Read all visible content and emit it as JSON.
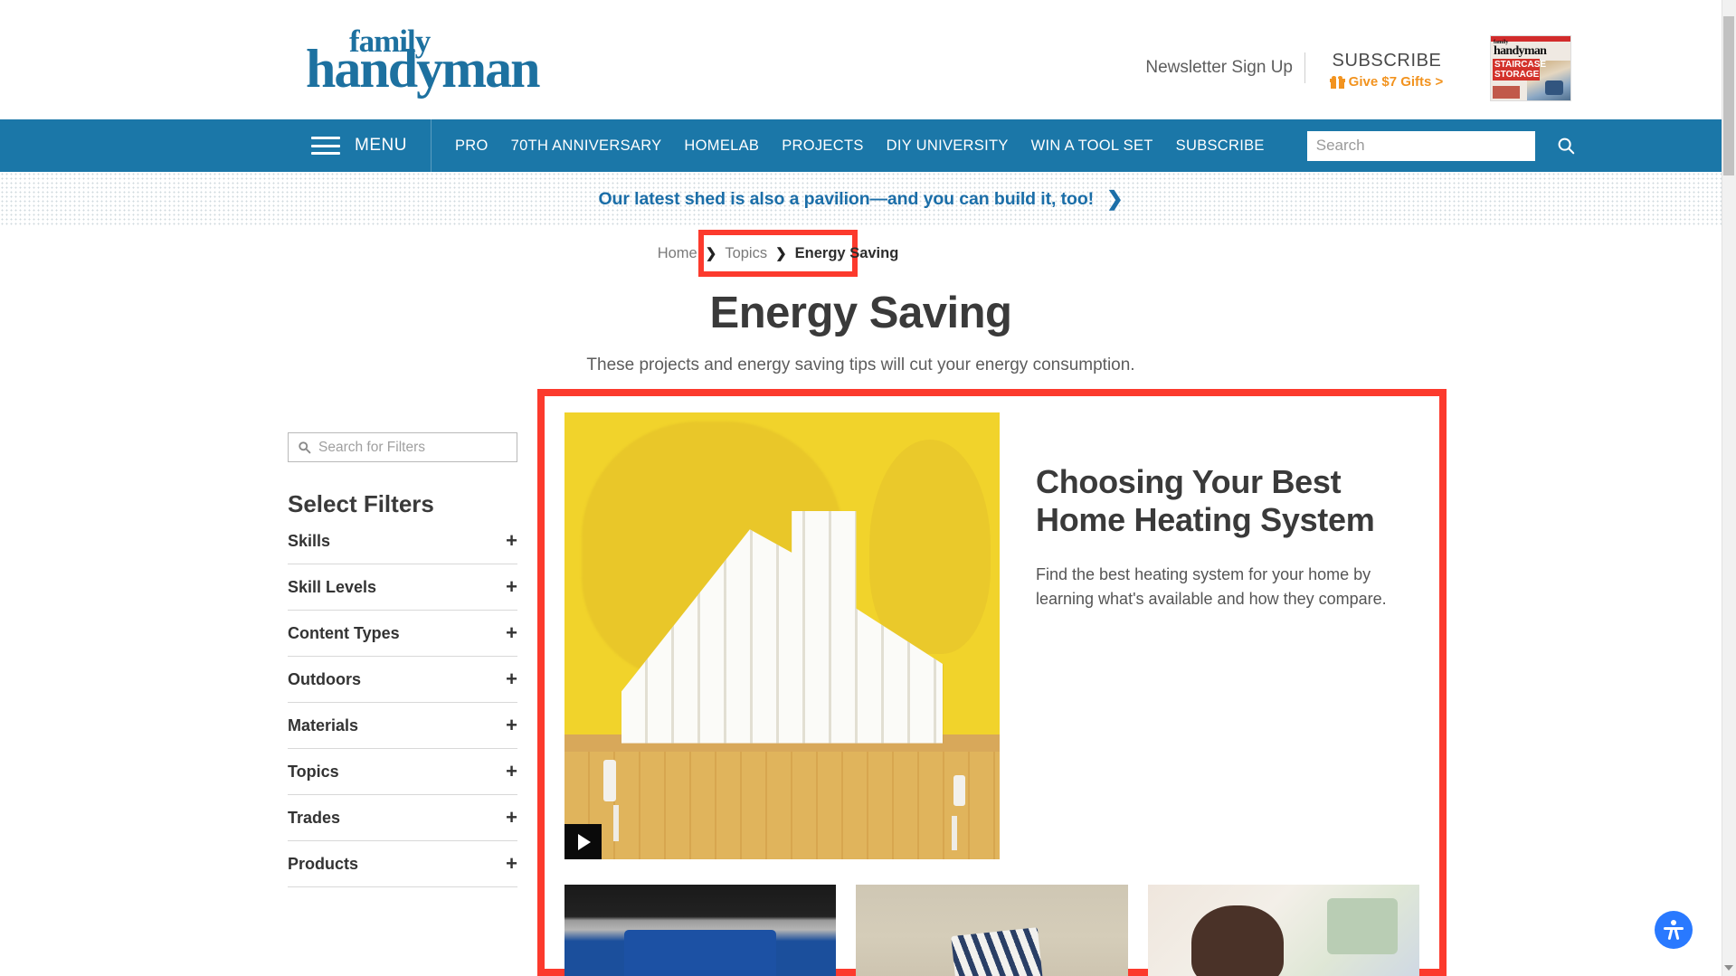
{
  "viewport": {
    "dimension_label": "1920px × 1080px"
  },
  "header": {
    "logo": {
      "line1": "family",
      "line2": "handyman"
    },
    "newsletter_label": "Newsletter Sign Up",
    "subscribe_label": "SUBSCRIBE",
    "gift_label": "Give $7 Gifts >",
    "magazine": {
      "brand_small": "family",
      "brand_big": "handyman",
      "cover_line1": "STAIRCASE",
      "cover_line2": "STORAGE"
    }
  },
  "nav": {
    "menu_label": "MENU",
    "items": [
      {
        "label": "PRO"
      },
      {
        "label": "70TH ANNIVERSARY"
      },
      {
        "label": "HOMELAB"
      },
      {
        "label": "PROJECTS"
      },
      {
        "label": "DIY UNIVERSITY"
      },
      {
        "label": "WIN A TOOL SET"
      },
      {
        "label": "SUBSCRIBE"
      }
    ],
    "search": {
      "placeholder": "Search",
      "value": ""
    }
  },
  "promo": {
    "text": "Our latest shed is also a pavilion—and you can build it, too!",
    "chevron": "❯"
  },
  "breadcrumb": {
    "home": "Home",
    "sep1": "❯",
    "topics": "Topics",
    "sep2": "❯",
    "current": "Energy Saving"
  },
  "page": {
    "title": "Energy Saving",
    "subtitle": "These projects and energy saving tips will cut your energy consumption."
  },
  "sidebar": {
    "search": {
      "placeholder": "Search for Filters",
      "value": ""
    },
    "heading": "Select Filters",
    "filters": [
      {
        "label": "Skills",
        "toggle": "+"
      },
      {
        "label": "Skill Levels",
        "toggle": "+"
      },
      {
        "label": "Content Types",
        "toggle": "+"
      },
      {
        "label": "Outdoors",
        "toggle": "+"
      },
      {
        "label": "Materials",
        "toggle": "+"
      },
      {
        "label": "Topics",
        "toggle": "+"
      },
      {
        "label": "Trades",
        "toggle": "+"
      },
      {
        "label": "Products",
        "toggle": "+"
      }
    ]
  },
  "featured": {
    "headline": "Choosing Your Best Home Heating System",
    "description": "Find the best heating system for your home by learning what's available and how they compare.",
    "media_type": "video"
  },
  "colors": {
    "brand_blue": "#1b77a8",
    "logo_blue": "#1d71a0",
    "accent_orange": "#f2931f",
    "annotation_red": "#fc3a2d",
    "hero_yellow": "#f1d32b",
    "a11y_blue": "#2979ff"
  }
}
